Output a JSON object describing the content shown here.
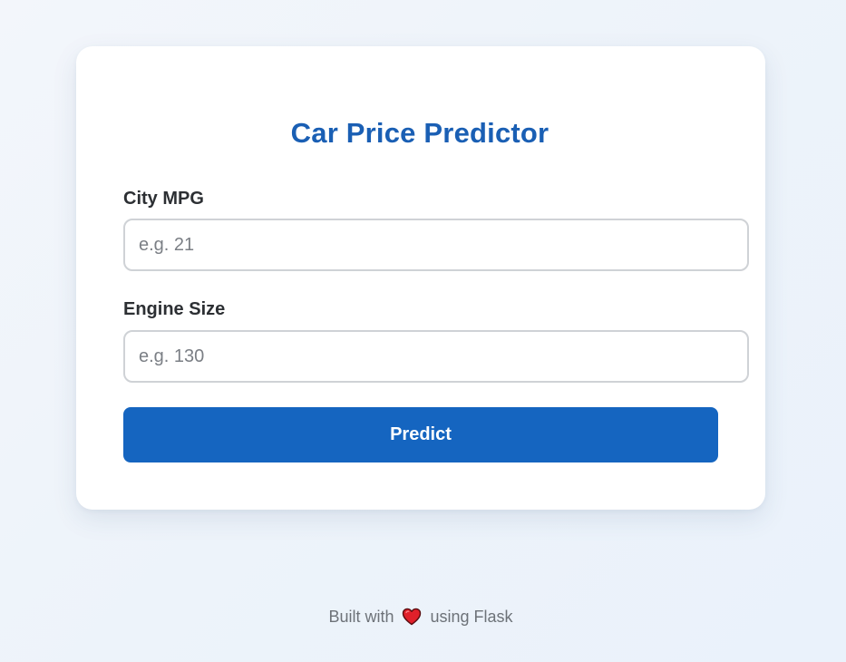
{
  "form": {
    "title": "Car Price Predictor",
    "city_mpg": {
      "label": "City MPG",
      "placeholder": "e.g. 21",
      "value": ""
    },
    "engine_size": {
      "label": "Engine Size",
      "placeholder": "e.g. 130",
      "value": ""
    },
    "submit_label": "Predict"
  },
  "footer": {
    "prefix": "Built with",
    "icon": "heart-icon",
    "suffix": "using Flask"
  },
  "colors": {
    "accent": "#1565c0",
    "title": "#1a5fb4",
    "heart": "#e0202a"
  }
}
